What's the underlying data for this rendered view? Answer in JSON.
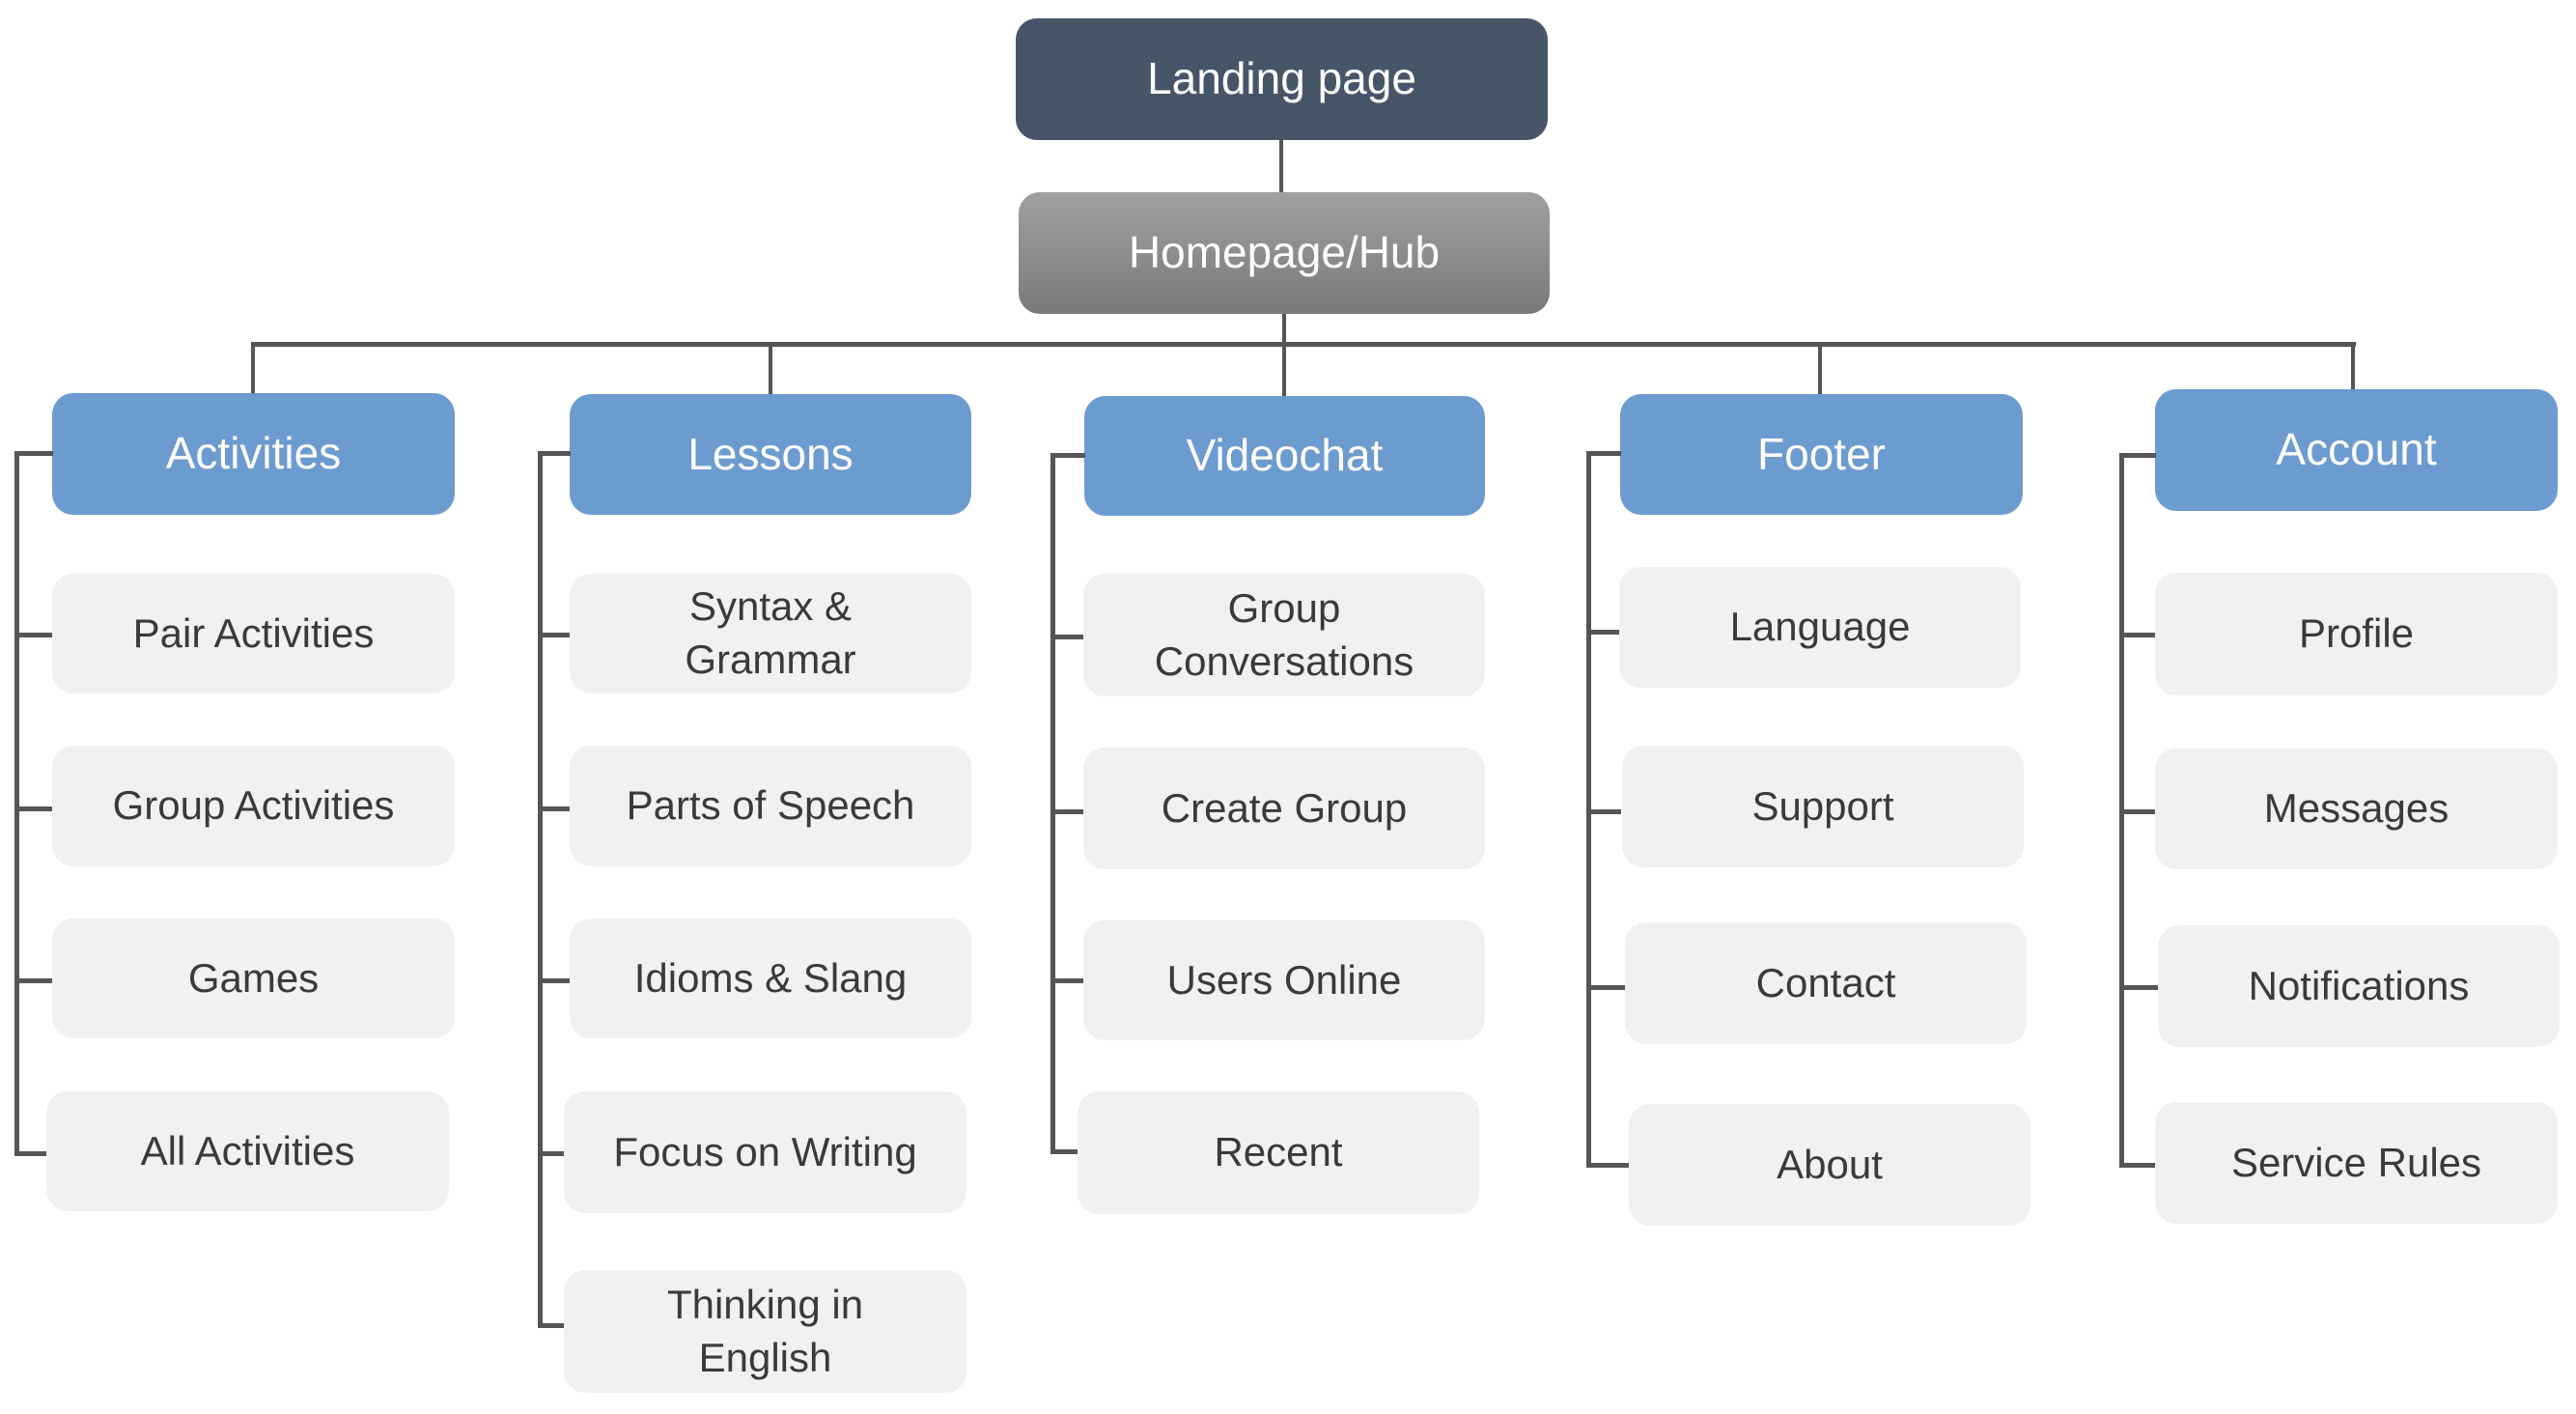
{
  "root": {
    "label": "Landing page"
  },
  "hub": {
    "label": "Homepage/Hub"
  },
  "colors": {
    "root": "#475569",
    "hub": "#8c8c8c",
    "header": "#6c9bd0",
    "leaf": "#f1f1f1",
    "connector": "#555555",
    "leaf_text": "#3a3a3a",
    "header_text": "#ffffff"
  },
  "sections": [
    {
      "label": "Activities",
      "children": [
        "Pair Activities",
        "Group Activities",
        "Games",
        "All Activities"
      ]
    },
    {
      "label": "Lessons",
      "children": [
        "Syntax & Grammar",
        "Parts of Speech",
        "Idioms & Slang",
        "Focus on Writing",
        "Thinking in English"
      ]
    },
    {
      "label": "Videochat",
      "children": [
        "Group Conversations",
        "Create Group",
        "Users Online",
        "Recent"
      ]
    },
    {
      "label": "Footer",
      "children": [
        "Language",
        "Support",
        "Contact",
        "About"
      ]
    },
    {
      "label": "Account",
      "children": [
        "Profile",
        "Messages",
        "Notifications",
        "Service Rules"
      ]
    }
  ]
}
